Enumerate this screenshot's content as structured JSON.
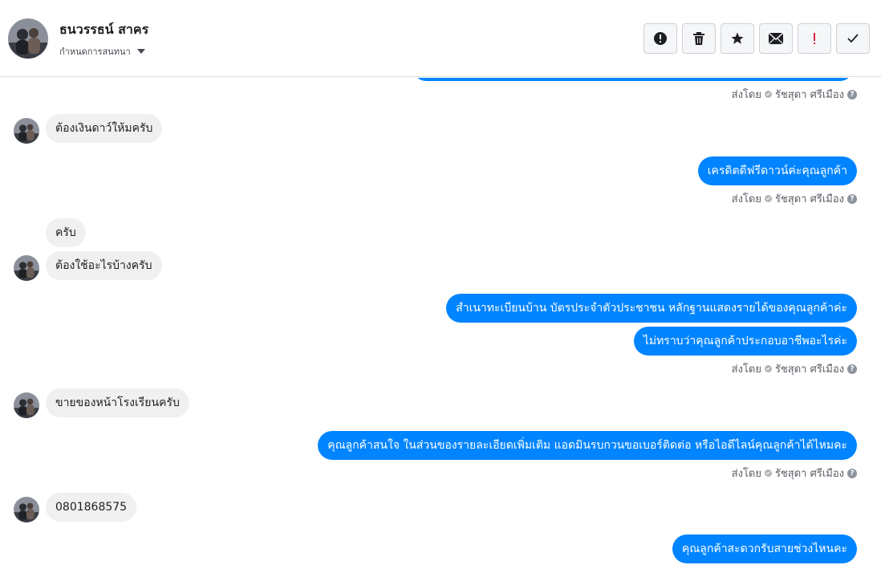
{
  "header": {
    "contact_name": "ธนวรรธน์ สาคร",
    "convo_menu_label": "กำหนดการสนทนา",
    "actions": [
      {
        "icon": "alert-circle-icon"
      },
      {
        "icon": "trash-icon"
      },
      {
        "icon": "star-icon"
      },
      {
        "icon": "envelope-icon"
      },
      {
        "icon": "exclamation-icon",
        "color": "#e41e3f"
      },
      {
        "icon": "checkmark-icon"
      }
    ]
  },
  "sent_by": {
    "prefix": "ส่งโดย",
    "agent": "รัชสุดา ศรีเมือง",
    "help": "?"
  },
  "messages": {
    "m1": "ต้องเงินดาว์ให้มครับ",
    "m2": "เครดิตดีฟรีดาวน์ค่ะคุณลูกค้า",
    "m3": "ครับ",
    "m4": "ต้องใช้อะไรบ้างครับ",
    "m5": "สำเนาทะเบียนบ้าน บัตรประจำตัวประชาชน หลักฐานแสดงรายได้ของคุณลูกค้าค่ะ",
    "m6": "ไม่ทราบว่าคุณลูกค้าประกอบอาชีพอะไรค่ะ",
    "m7": "ขายของหน้าโรงเรียนครับ",
    "m8": "คุณลูกค้าสนใจ ในส่วนของรายละเอียดเพิ่มเติม แอดมินรบกวนขอเบอร์ติดต่อ หรือไอดีไลน์คุณลูกค้าได้ไหมคะ",
    "m9": "0801868575",
    "m10": "คุณลูกค้าสะดวกรับสายช่วงไหนคะ"
  },
  "colors": {
    "outgoing_bubble": "#0084ff",
    "incoming_bubble": "#f0f0f0",
    "accent_red": "#e41e3f"
  }
}
